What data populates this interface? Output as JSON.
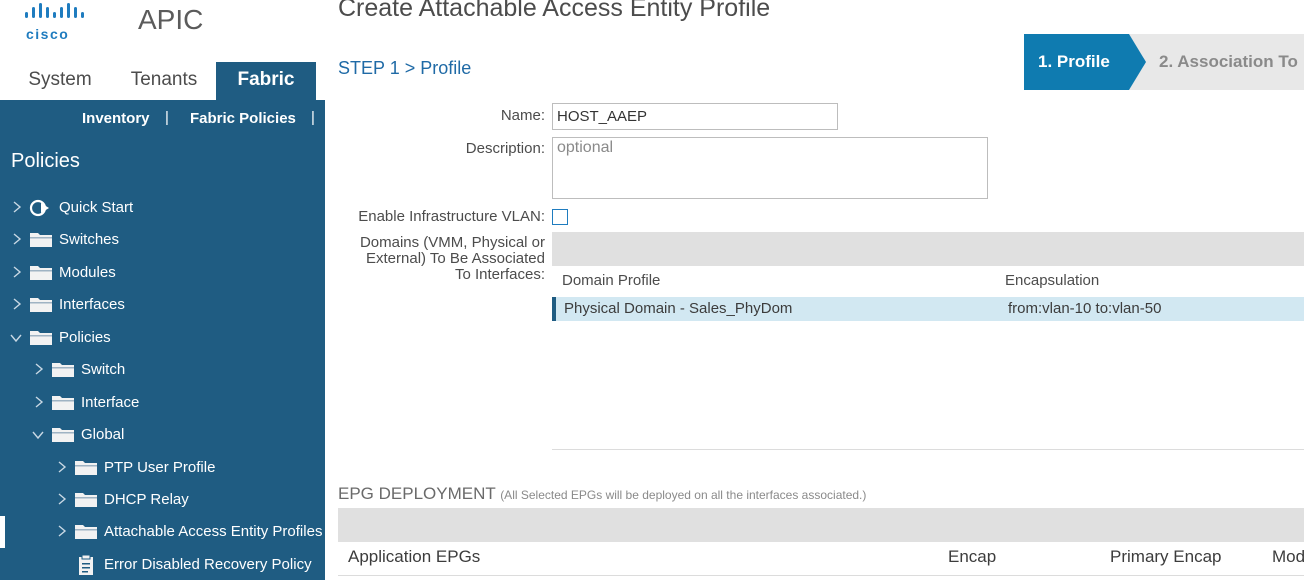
{
  "brand": {
    "logo_text": "cisco",
    "app_name": "APIC"
  },
  "main_tabs": [
    {
      "label": "System"
    },
    {
      "label": "Tenants"
    },
    {
      "label": "Fabric",
      "active": true
    }
  ],
  "sub_tabs": [
    {
      "label": "Inventory"
    },
    {
      "label": "Fabric Policies"
    }
  ],
  "sub_tab_separator": "|",
  "sidebar": {
    "heading": "Policies",
    "tree": [
      {
        "label": "Quick Start",
        "icon": "quick-start-icon",
        "expanded": false
      },
      {
        "label": "Switches",
        "icon": "folder-icon",
        "expanded": false
      },
      {
        "label": "Modules",
        "icon": "folder-icon",
        "expanded": false
      },
      {
        "label": "Interfaces",
        "icon": "folder-icon",
        "expanded": false
      },
      {
        "label": "Policies",
        "icon": "folder-icon",
        "expanded": true
      },
      {
        "label": "Switch",
        "icon": "folder-icon",
        "expanded": false
      },
      {
        "label": "Interface",
        "icon": "folder-icon",
        "expanded": false
      },
      {
        "label": "Global",
        "icon": "folder-icon",
        "expanded": true
      },
      {
        "label": "PTP User Profile",
        "icon": "folder-icon",
        "expanded": false
      },
      {
        "label": "DHCP Relay",
        "icon": "folder-icon",
        "expanded": false
      },
      {
        "label": "Attachable Access Entity Profiles",
        "icon": "folder-icon",
        "expanded": false,
        "selected": true
      },
      {
        "label": "Error Disabled Recovery Policy",
        "icon": "policy-doc-icon"
      }
    ]
  },
  "page": {
    "title": "Create Attachable Access Entity Profile",
    "step": "STEP 1 > Profile",
    "wizard": {
      "step1": "1. Profile",
      "step2": "2. Association To"
    }
  },
  "form": {
    "name_label": "Name:",
    "name_value": "HOST_AAEP",
    "description_label": "Description:",
    "description_placeholder": "optional",
    "infra_vlan_label": "Enable Infrastructure VLAN:",
    "infra_vlan_checked": false,
    "domains_label_line1": "Domains (VMM, Physical or",
    "domains_label_line2": "External) To Be Associated",
    "domains_label_line3": "To Interfaces:"
  },
  "domain_table": {
    "columns": [
      "Domain Profile",
      "Encapsulation"
    ],
    "rows": [
      {
        "domain": "Physical Domain - Sales_PhyDom",
        "encap": "from:vlan-10 to:vlan-50"
      }
    ]
  },
  "epg": {
    "heading": "EPG DEPLOYMENT",
    "note": "(All Selected EPGs will be deployed on all the interfaces associated.)",
    "columns": [
      "Application EPGs",
      "Encap",
      "Primary Encap",
      "Mod"
    ]
  },
  "colors": {
    "brand_blue": "#1f5c82",
    "accent_blue": "#0f7bb0",
    "link_blue": "#1f6aa6",
    "row_highlight": "#d2e8f2"
  }
}
